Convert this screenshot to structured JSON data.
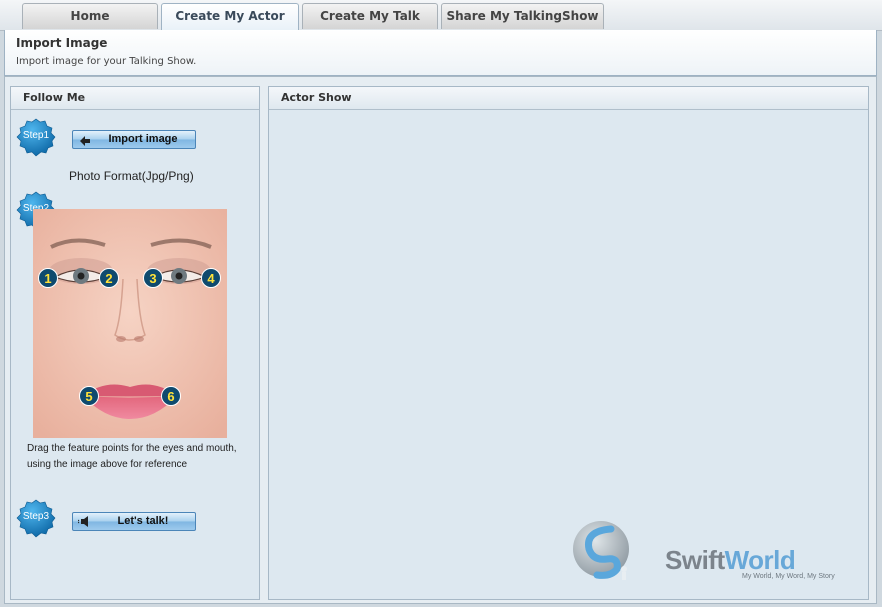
{
  "tabs": [
    {
      "label": "Home"
    },
    {
      "label": "Create My Actor",
      "active": true
    },
    {
      "label": "Create My Talk"
    },
    {
      "label": "Share My TalkingShow"
    }
  ],
  "info": {
    "title": "Import Image",
    "subtitle": "Import image for your Talking Show."
  },
  "follow_me": {
    "title": "Follow Me",
    "step1": {
      "badge": "Step1",
      "button": "Import image",
      "format": "Photo Format(Jpg/Png)"
    },
    "step2": {
      "badge": "Step2",
      "points": [
        "1",
        "2",
        "3",
        "4",
        "5",
        "6"
      ],
      "note": "Drag the feature points for the eyes and mouth, using the image above for reference"
    },
    "step3": {
      "badge": "Step3",
      "button": "Let's talk!"
    }
  },
  "actor_show": {
    "title": "Actor Show"
  },
  "brand": {
    "name_part1": "Swift",
    "name_part2": "World",
    "tagline": "My World, My Word, My Story"
  },
  "colors": {
    "accent": "#68a8d8",
    "badge": "#1a7fc0",
    "panel": "#dde8f0"
  }
}
